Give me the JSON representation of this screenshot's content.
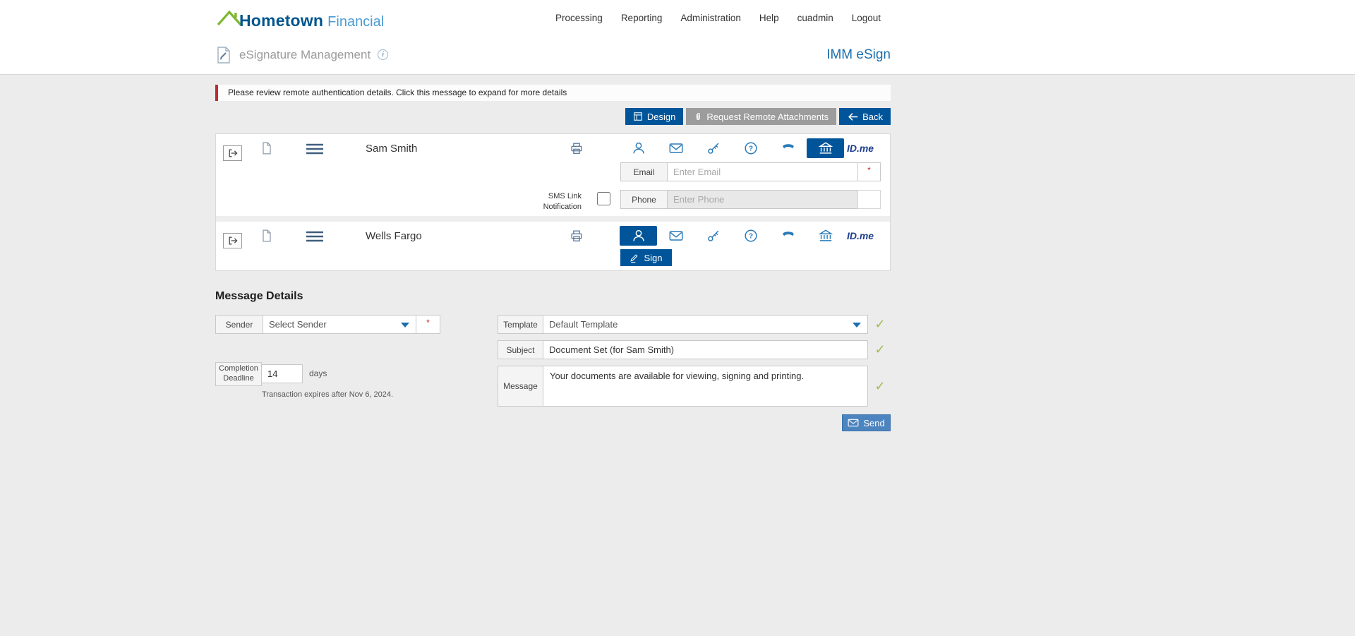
{
  "colors": {
    "accent_blue": "#00559a",
    "brand_blue": "#1b6fad",
    "logo_green": "#7cb82f",
    "alert_red": "#c02b2b",
    "check_green": "#9fbe52",
    "send_blue": "#4c84bf"
  },
  "header": {
    "logo_primary": "Hometown",
    "logo_secondary": "Financial",
    "nav": [
      {
        "label": "Processing"
      },
      {
        "label": "Reporting"
      },
      {
        "label": "Administration"
      },
      {
        "label": "Help"
      },
      {
        "label": "cuadmin"
      },
      {
        "label": "Logout"
      }
    ]
  },
  "subheader": {
    "title": "eSignature Management",
    "brand": "IMM eSign"
  },
  "alert": {
    "text": "Please review remote authentication details. Click this message to expand for more details"
  },
  "toolbar": {
    "design_label": "Design",
    "attachments_label": "Request Remote Attachments",
    "back_label": "Back"
  },
  "idme_label": "ID.me",
  "parties": [
    {
      "name": "Sam Smith",
      "email_label": "Email",
      "email_placeholder": "Enter Email",
      "sms_label": "SMS Link Notification",
      "phone_label": "Phone",
      "phone_placeholder": "Enter Phone"
    },
    {
      "name": "Wells Fargo",
      "sign_label": "Sign"
    }
  ],
  "message_details": {
    "heading": "Message Details",
    "sender_label": "Sender",
    "sender_value": "Select Sender",
    "completion_label": "Completion Deadline",
    "completion_value": "14",
    "days_label": "days",
    "expiry_note": "Transaction expires after Nov 6, 2024.",
    "template_label": "Template",
    "template_value": "Default Template",
    "subject_label": "Subject",
    "subject_value": "Document Set (for Sam Smith)",
    "message_label": "Message",
    "message_value": "Your documents are available for viewing, signing and printing.",
    "send_label": "Send"
  }
}
